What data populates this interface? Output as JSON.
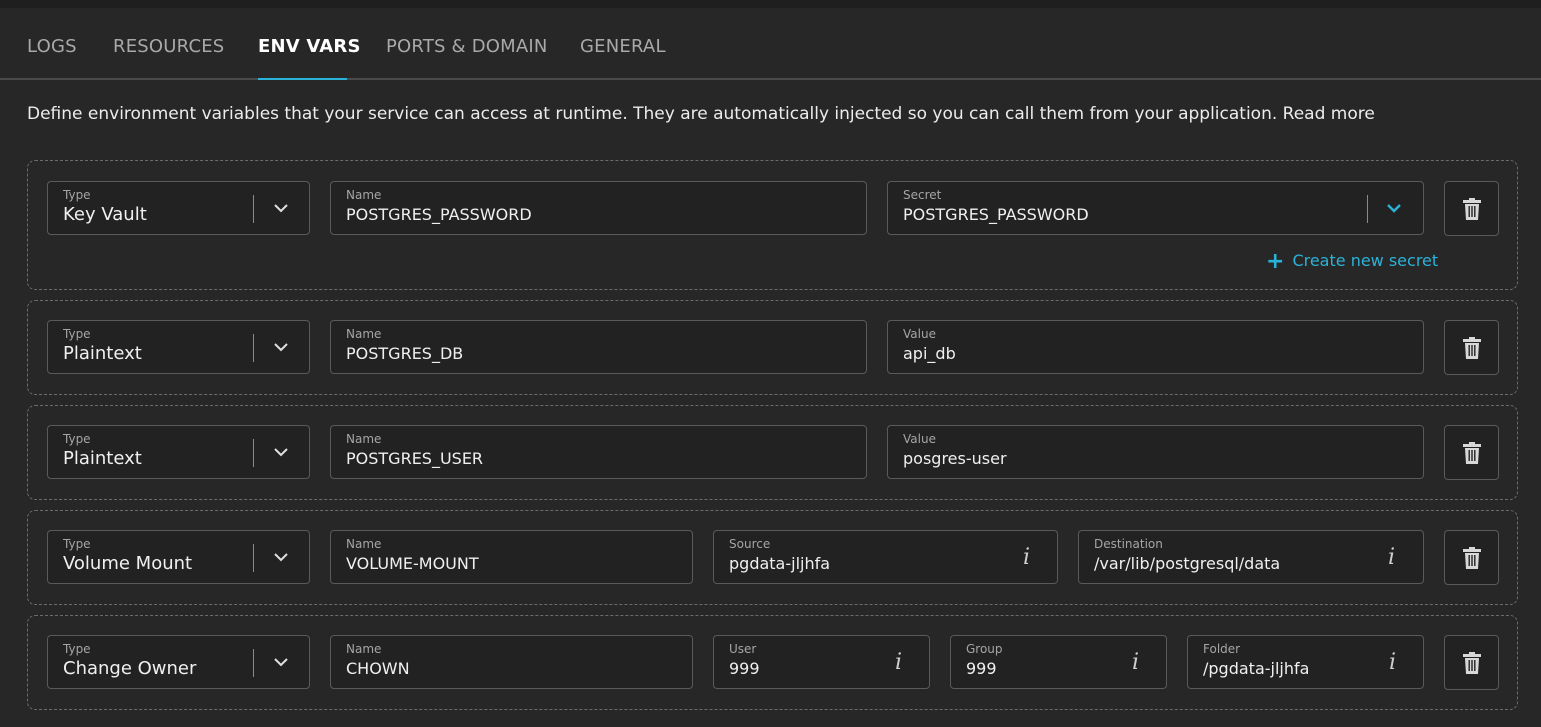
{
  "tabs": [
    "LOGS",
    "RESOURCES",
    "ENV VARS",
    "PORTS & DOMAIN",
    "GENERAL"
  ],
  "active_tab": "ENV VARS",
  "description": {
    "text": "Define environment variables that your service can access at runtime. They are automatically injected so you can call them from your application.",
    "link": "Read more"
  },
  "labels": {
    "type": "Type",
    "name": "Name",
    "secret": "Secret",
    "value": "Value",
    "source": "Source",
    "destination": "Destination",
    "user": "User",
    "group": "Group",
    "folder": "Folder"
  },
  "create_secret_label": "Create new secret",
  "rows": [
    {
      "type": "Key Vault",
      "name": "POSTGRES_PASSWORD",
      "secret": "POSTGRES_PASSWORD"
    },
    {
      "type": "Plaintext",
      "name": "POSTGRES_DB",
      "value": "api_db"
    },
    {
      "type": "Plaintext",
      "name": "POSTGRES_USER",
      "value": "posgres-user"
    },
    {
      "type": "Volume Mount",
      "name": "VOLUME-MOUNT",
      "source": "pgdata-jljhfa",
      "destination": "/var/lib/postgresql/data"
    },
    {
      "type": "Change Owner",
      "name": "CHOWN",
      "user": "999",
      "group": "999",
      "folder": "/pgdata-jljhfa"
    }
  ],
  "icons": {
    "dropdown": "chevron-down-icon",
    "delete": "trash-icon",
    "info": "info-icon",
    "add": "plus-icon"
  },
  "colors": {
    "accent": "#2ab3d8",
    "background": "#272727",
    "field_background": "#222222"
  }
}
